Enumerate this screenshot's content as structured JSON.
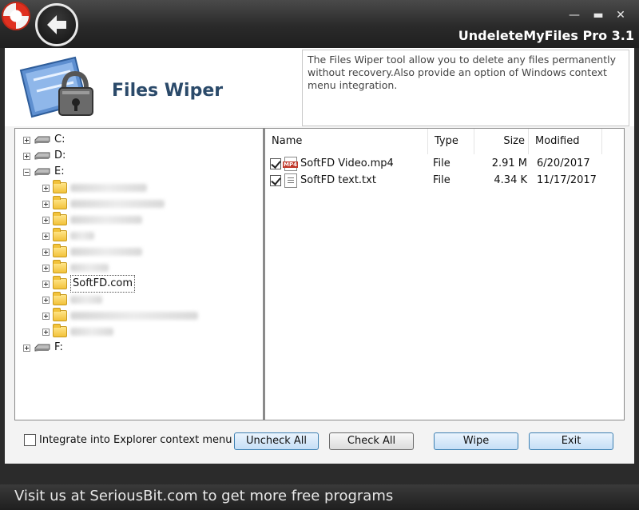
{
  "window": {
    "title": "UndeleteMyFiles Pro 3.1",
    "minimize": "—",
    "maximize": "▬",
    "close": "✕"
  },
  "header": {
    "tool_title": "Files Wiper",
    "description": "The Files Wiper tool allow you to delete any files permanently without recovery.Also provide an option of Windows context menu integration."
  },
  "tree": {
    "drives": [
      "C:",
      "D:",
      "E:",
      "F:"
    ],
    "selected_folder": "SoftFD.com"
  },
  "list": {
    "columns": [
      "Name",
      "Type",
      "Size",
      "Modified"
    ],
    "rows": [
      {
        "name": "SoftFD Video.mp4",
        "type": "File",
        "size": "2.91 M",
        "modified": "6/20/2017",
        "icon": "mp4-file-icon",
        "checked": true
      },
      {
        "name": "SoftFD text.txt",
        "type": "File",
        "size": "4.34 K",
        "modified": "11/17/2017",
        "icon": "text-file-icon",
        "checked": true
      }
    ]
  },
  "controls": {
    "integrate_label": "Integrate into Explorer context menu",
    "uncheck_all": "Uncheck All",
    "check_all": "Check All",
    "wipe": "Wipe",
    "exit": "Exit"
  },
  "footer": {
    "text": "Visit us at SeriousBit.com to get more free programs"
  },
  "colors": {
    "accent_blue": "#3c7fb1",
    "title_color": "#2b4a6a"
  }
}
